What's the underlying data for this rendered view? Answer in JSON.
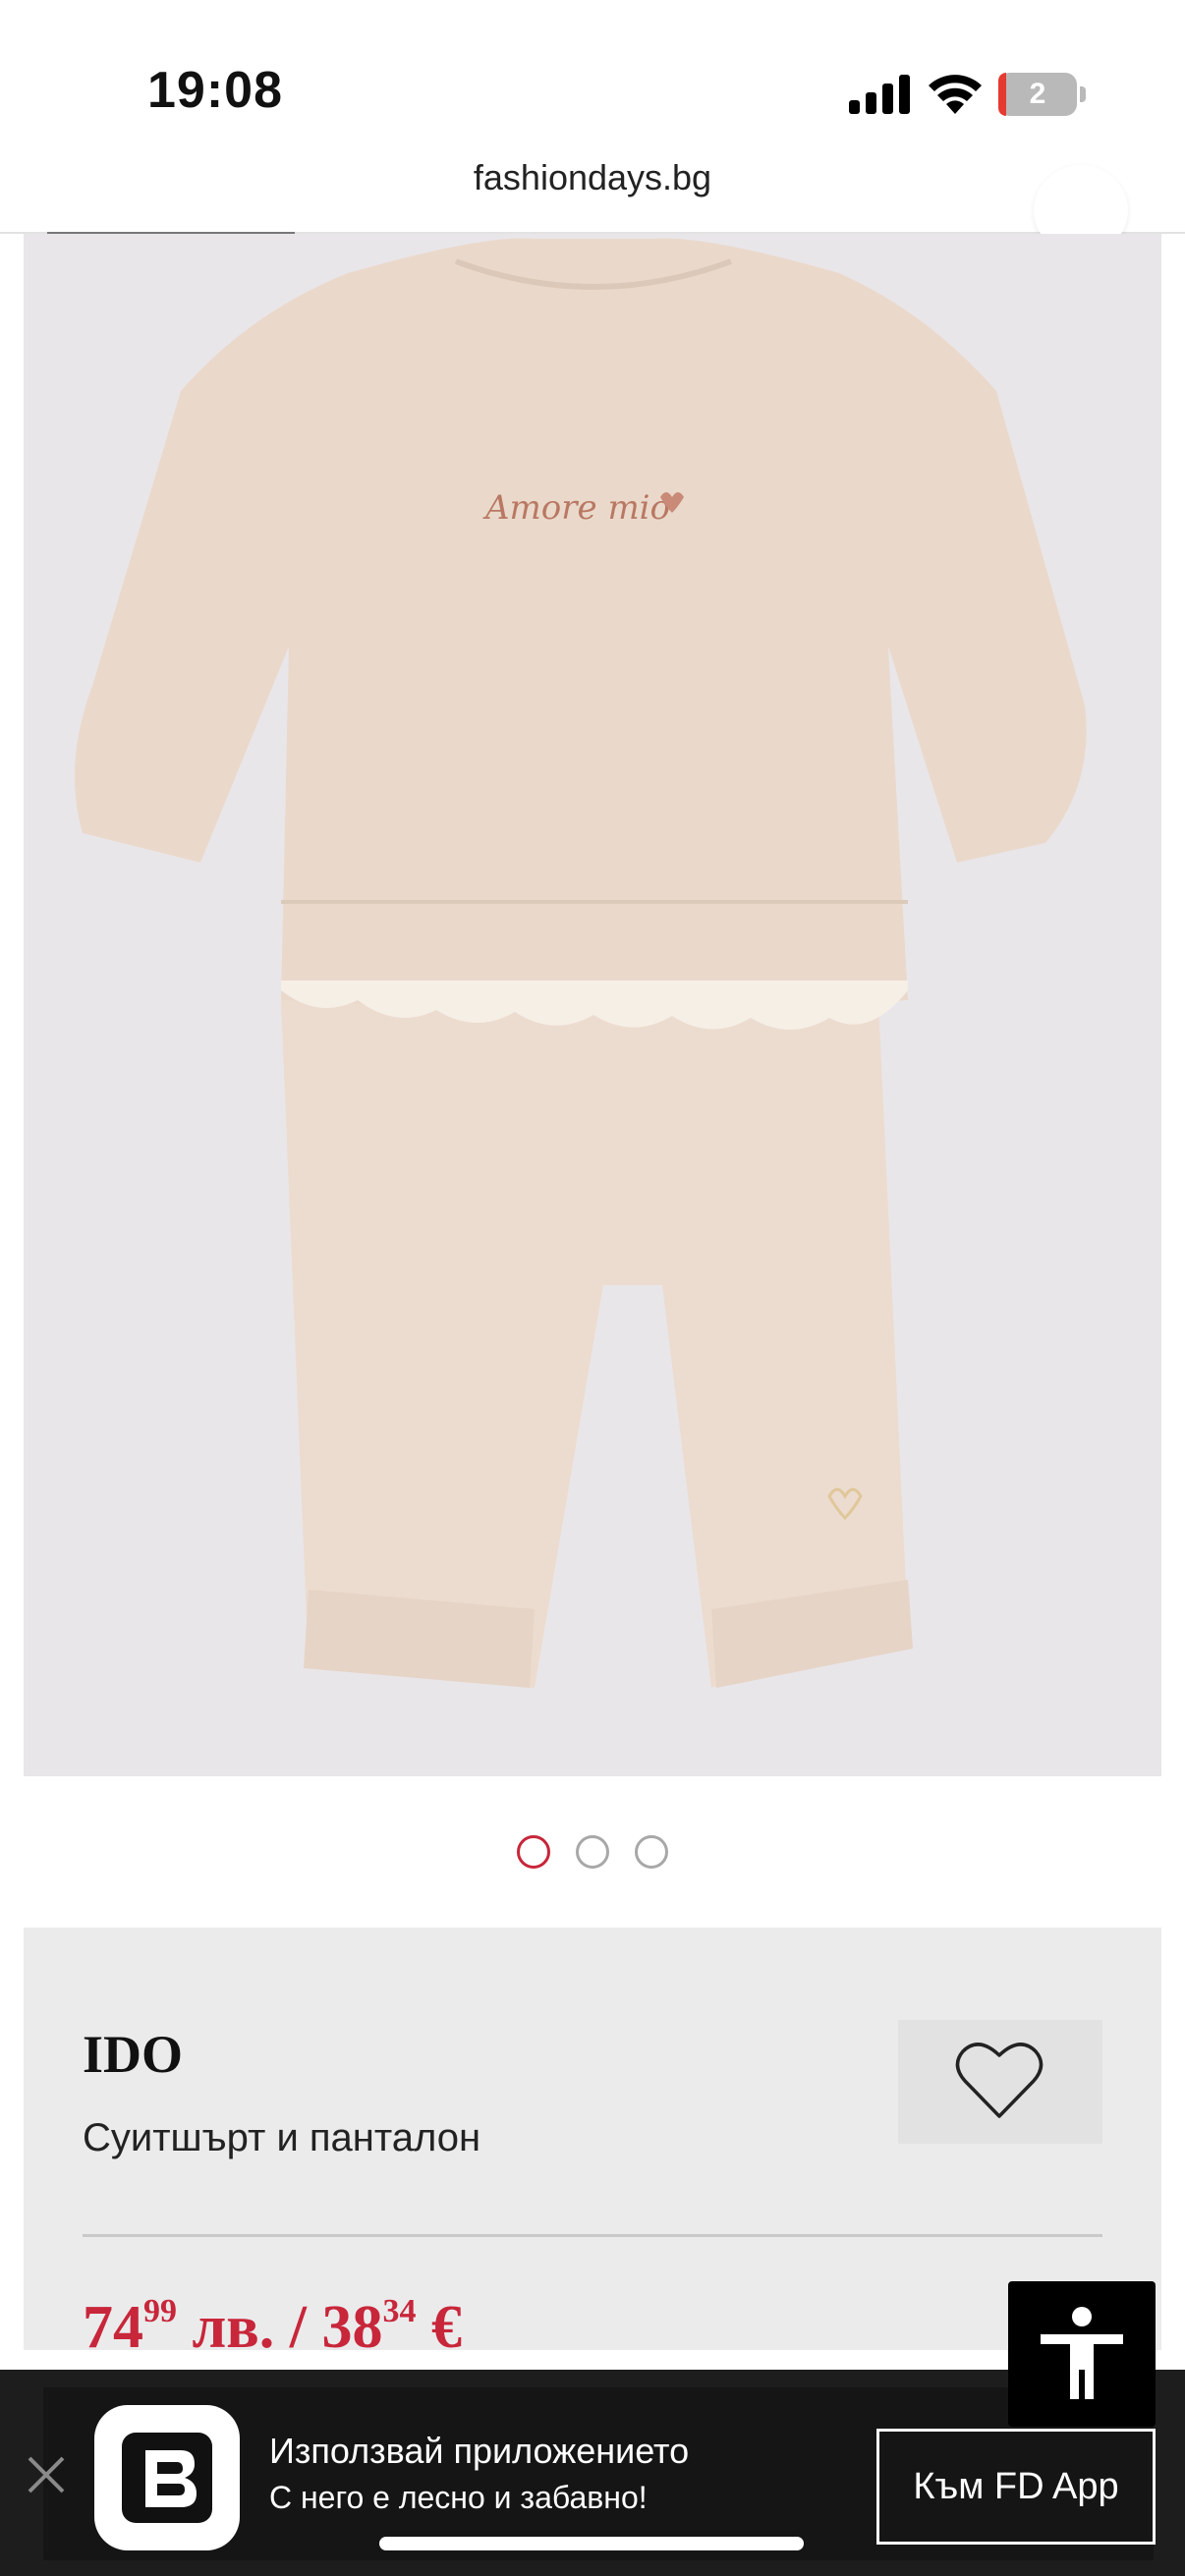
{
  "status_bar": {
    "time": "19:08",
    "battery_level": "2",
    "icons": [
      "cellular-signal-icon",
      "wifi-icon",
      "battery-icon"
    ]
  },
  "browser": {
    "url": "fashiondays.bg"
  },
  "product": {
    "image_alt": "Beige baby sweatshirt with lace trim and matching trousers, embroidered text",
    "image_text": "Amore mio",
    "carousel": {
      "total": 3,
      "active": 1
    },
    "brand": "IDO",
    "name": "Суитшърт и панталон",
    "price": {
      "bgn_int": "74",
      "bgn_dec": "99",
      "bgn_unit": "лв.",
      "separator": "/",
      "eur_int": "38",
      "eur_dec": "34",
      "eur_unit": "€"
    }
  },
  "app_banner": {
    "title": "Използвай приложението",
    "subtitle": "С него е лесно и забавно!",
    "cta": "Към FD App"
  },
  "colors": {
    "accent_red": "#c8263a",
    "card_bg": "#ebebec",
    "banner_bg": "#1d1d1d",
    "product_bg": "#e9e6ea",
    "garment": "#ead9cb"
  }
}
